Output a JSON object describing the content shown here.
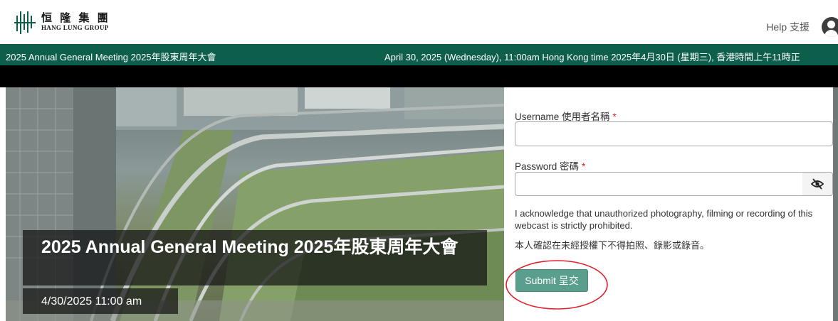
{
  "header": {
    "logo_cn": "恒 隆 集 團",
    "logo_en": "HANG LUNG GROUP",
    "help_label": "Help 支援",
    "avatar_icon": "user-avatar-icon"
  },
  "event_bar": {
    "title": "2025 Annual General Meeting 2025年股東周年大會",
    "datetime": "April 30, 2025 (Wednesday), 11:00am Hong Kong time 2025年4月30日 (星期三), 香港時間上午11時正"
  },
  "hero": {
    "title": "2025 Annual General Meeting 2025年股東周年大會",
    "date": "4/30/2025 11:00 am"
  },
  "login": {
    "username_label": "Username 使用者名稱",
    "username_value": "",
    "password_label": "Password 密碼",
    "password_value": "",
    "required_mark": "*",
    "toggle_icon": "eye-slash-icon",
    "ack_en": "I acknowledge that unauthorized photography, filming or recording of this webcast is strictly prohibited.",
    "ack_cn": "本人確認在未經授權下不得拍照、錄影或錄音。",
    "submit_label": "Submit 呈交"
  },
  "colors": {
    "brand_green": "#0d5f4b",
    "submit_bg": "#5a9e8d",
    "required_red": "#d9232e",
    "highlight_red": "#e0202a"
  }
}
